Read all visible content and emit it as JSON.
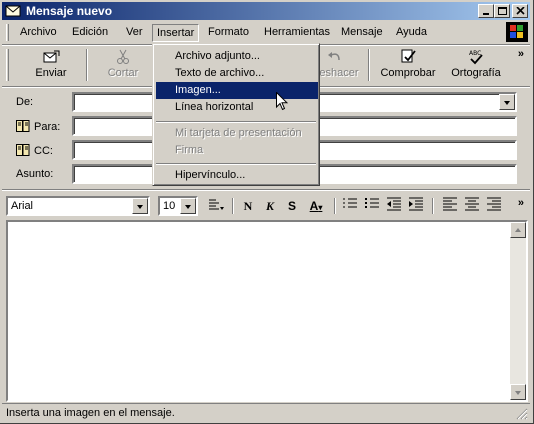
{
  "window": {
    "title": "Mensaje nuevo",
    "controls": [
      "minimize",
      "maximize",
      "close"
    ]
  },
  "menubar": {
    "items": [
      "Archivo",
      "Edición",
      "Ver",
      "Insertar",
      "Formato",
      "Herramientas",
      "Mensaje",
      "Ayuda"
    ],
    "open_menu": "Insertar"
  },
  "toolbar": {
    "send": "Enviar",
    "cut": "Cortar",
    "undo": "Deshacer",
    "check": "Comprobar",
    "spelling": "Ortografía",
    "more": "»"
  },
  "header_fields": {
    "from_label": "De:",
    "to_label": "Para:",
    "cc_label": "CC:",
    "subject_label": "Asunto:",
    "from_value": "",
    "to_value": "",
    "cc_value": "",
    "subject_value": ""
  },
  "format_bar": {
    "font": "Arial",
    "size": "10",
    "more": "»",
    "bold": "N",
    "italic": "K",
    "underline": "S",
    "font_color": "A"
  },
  "insert_menu": {
    "items": [
      {
        "label": "Archivo adjunto...",
        "state": "normal"
      },
      {
        "label": "Texto de archivo...",
        "state": "normal"
      },
      {
        "label": "Imagen...",
        "state": "highlighted"
      },
      {
        "label": "Línea horizontal",
        "state": "normal"
      },
      {
        "label": "Mi tarjeta de presentación",
        "state": "disabled"
      },
      {
        "label": "Firma",
        "state": "disabled"
      },
      {
        "label": "Hipervínculo...",
        "state": "normal"
      }
    ]
  },
  "statusbar": {
    "text": "Inserta una imagen en el mensaje."
  },
  "colors": {
    "title_start": "#0a246a",
    "title_end": "#a6caf0",
    "face": "#d4d0c8",
    "highlight": "#0a246a"
  },
  "icons": [
    "envelope-icon",
    "send-icon",
    "scissors-icon",
    "undo-icon",
    "check-names-icon",
    "spelling-icon",
    "address-book-icon",
    "paragraph-style-icon",
    "numbered-list-icon",
    "bullet-list-icon",
    "decrease-indent-icon",
    "increase-indent-icon",
    "align-left-icon",
    "align-center-icon",
    "align-right-icon",
    "windows-logo-icon"
  ]
}
